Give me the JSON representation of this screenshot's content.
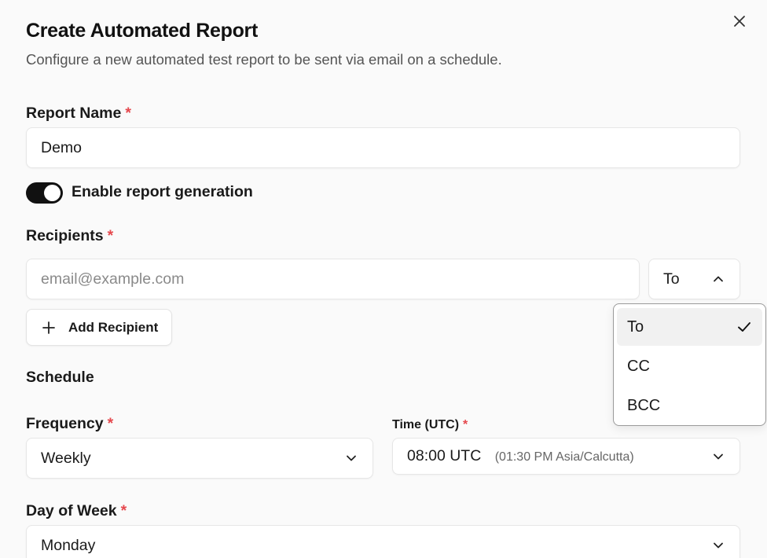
{
  "dialog": {
    "title": "Create Automated Report",
    "subtitle": "Configure a new automated test report to be sent via email on a schedule."
  },
  "report_name": {
    "label": "Report Name",
    "required_mark": "*",
    "value": "Demo"
  },
  "enable_toggle": {
    "label": "Enable report generation",
    "checked": true
  },
  "recipients": {
    "label": "Recipients",
    "required_mark": "*",
    "email_placeholder": "email@example.com",
    "email_value": "",
    "type_selected": "To",
    "add_button_label": "Add Recipient"
  },
  "recipient_type_menu": {
    "open": true,
    "options": [
      {
        "label": "To",
        "selected": true
      },
      {
        "label": "CC",
        "selected": false
      },
      {
        "label": "BCC",
        "selected": false
      }
    ]
  },
  "schedule": {
    "section_title": "Schedule",
    "frequency": {
      "label": "Frequency",
      "required_mark": "*",
      "value": "Weekly"
    },
    "time": {
      "label": "Time (UTC)",
      "required_mark": "*",
      "value": "08:00 UTC",
      "local_hint": "(01:30 PM Asia/Calcutta)"
    },
    "day_of_week": {
      "label": "Day of Week",
      "required_mark": "*",
      "value": "Monday"
    }
  },
  "icons": {
    "close": "close-icon",
    "chevron_down": "chevron-down-icon",
    "chevron_up": "chevron-up-icon",
    "plus": "plus-icon",
    "check": "check-icon"
  },
  "colors": {
    "required": "#e5484d",
    "toggle_on": "#111111",
    "background": "#fafafa"
  }
}
